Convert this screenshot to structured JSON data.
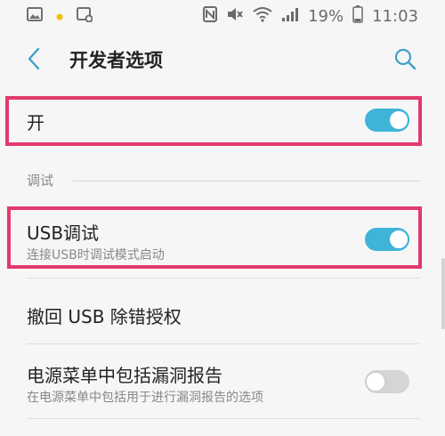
{
  "status_bar": {
    "battery_percent": "19%",
    "time": "11:03",
    "icons": [
      "image-icon",
      "notification-dot-icon",
      "calendar-icon",
      "nfc-icon",
      "mute-icon",
      "wifi-icon",
      "signal-icon",
      "battery-icon"
    ]
  },
  "app_bar": {
    "title": "开发者选项",
    "back_icon": "chevron-left-icon",
    "search_icon": "search-icon"
  },
  "master_switch": {
    "label": "开",
    "state": "on"
  },
  "debug_section": {
    "header": "调试"
  },
  "usb_debugging": {
    "label": "USB调试",
    "summary": "连接USB时调试模式启动",
    "state": "on"
  },
  "revoke_usb": {
    "label": "撤回 USB 除错授权"
  },
  "bug_report": {
    "label": "电源菜单中包括漏洞报告",
    "summary": "在电源菜单中包括用于进行漏洞报告的选项",
    "state": "off"
  },
  "colors": {
    "accent": "#3fb4d8",
    "highlight": "#e23a6c"
  }
}
